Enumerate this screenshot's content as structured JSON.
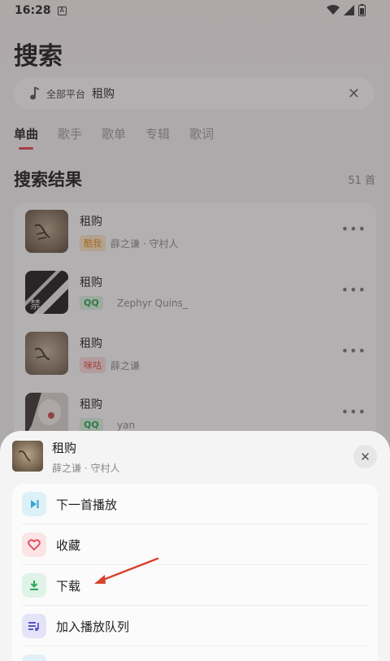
{
  "status_bar": {
    "time": "16:28"
  },
  "page": {
    "title": "搜索"
  },
  "search": {
    "platform": "全部平台",
    "query": "租购"
  },
  "tabs": [
    "单曲",
    "歌手",
    "歌单",
    "专辑",
    "歌词"
  ],
  "results": {
    "title": "搜索结果",
    "count": "51 首",
    "items": [
      {
        "title": "租购",
        "source": "酷我",
        "artist": "薛之谦 · 守村人"
      },
      {
        "title": "租购",
        "source": "QQ",
        "artist": "Zephyr Quins_"
      },
      {
        "title": "租购",
        "source": "咪咕",
        "artist": "薛之谦"
      },
      {
        "title": "租购",
        "source": "QQ",
        "artist": "yan"
      }
    ]
  },
  "sheet": {
    "song_title": "租购",
    "song_sub": "薛之谦 · 守村人",
    "actions": [
      {
        "label": "下一首播放",
        "icon": "play-next-icon"
      },
      {
        "label": "收藏",
        "icon": "heart-icon"
      },
      {
        "label": "下载",
        "icon": "download-icon"
      },
      {
        "label": "加入播放队列",
        "icon": "queue-icon"
      }
    ]
  },
  "colors": {
    "accent": "#e3434b",
    "arrow": "#d9432f"
  }
}
